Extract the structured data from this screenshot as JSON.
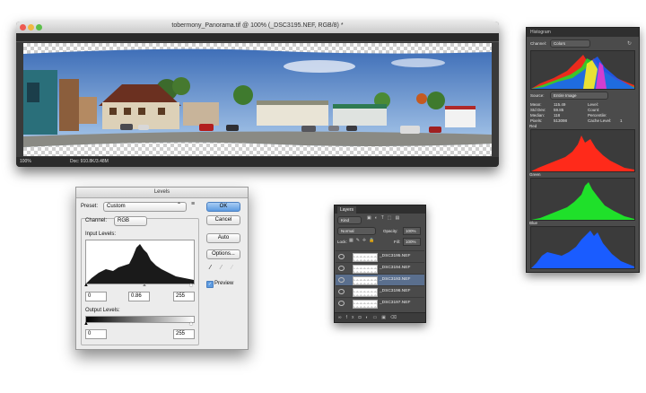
{
  "document": {
    "title": "tobermony_Panorama.tif @ 100% (_DSC3195.NEF, RGB/8) *",
    "zoom": "100%",
    "doc_size": "Doc: 910.8K/3.48M"
  },
  "histogram": {
    "panel_title": "Histogram",
    "channel_label": "Channel:",
    "channel_value": "Colors",
    "source_label": "Source:",
    "source_value": "Entire Image",
    "stats": {
      "mean_label": "Mean:",
      "mean_value": "115.49",
      "stddev_label": "Std Dev:",
      "stddev_value": "59.85",
      "median_label": "Median:",
      "median_value": "118",
      "pixels_label": "Pixels:",
      "pixels_value": "513098",
      "level_label": "Level:",
      "count_label": "Count:",
      "percentile_label": "Percentile:",
      "cache_label": "Cache Level:",
      "cache_value": "1"
    },
    "graphs": {
      "red": "Red",
      "green": "Green",
      "blue": "Blue"
    },
    "colors": {
      "red": "#ff2a1a",
      "green": "#1fe02a",
      "blue": "#1a5cff"
    }
  },
  "levels": {
    "title": "Levels",
    "preset_label": "Preset:",
    "preset_value": "Custom",
    "channel_label": "Channel:",
    "channel_value": "RGB",
    "input_levels_label": "Input Levels:",
    "input_black": "0",
    "input_gamma": "0.86",
    "input_white": "255",
    "output_levels_label": "Output Levels:",
    "output_black": "0",
    "output_white": "255",
    "ok_label": "OK",
    "cancel_label": "Cancel",
    "auto_label": "Auto",
    "options_label": "Options...",
    "preview_label": "Preview"
  },
  "layers": {
    "tab_label": "Layers",
    "kind_label": "Kind",
    "blend_mode": "Normal",
    "opacity_label": "Opacity:",
    "opacity_value": "100%",
    "lock_label": "Lock:",
    "fill_label": "Fill:",
    "fill_value": "100%",
    "items": [
      {
        "name": "_DSC3195.NEF"
      },
      {
        "name": "_DSC3194.NEF"
      },
      {
        "name": "_DSC3193.NEF"
      },
      {
        "name": "_DSC3196.NEF"
      },
      {
        "name": "_DSC3197.NEF"
      }
    ]
  }
}
